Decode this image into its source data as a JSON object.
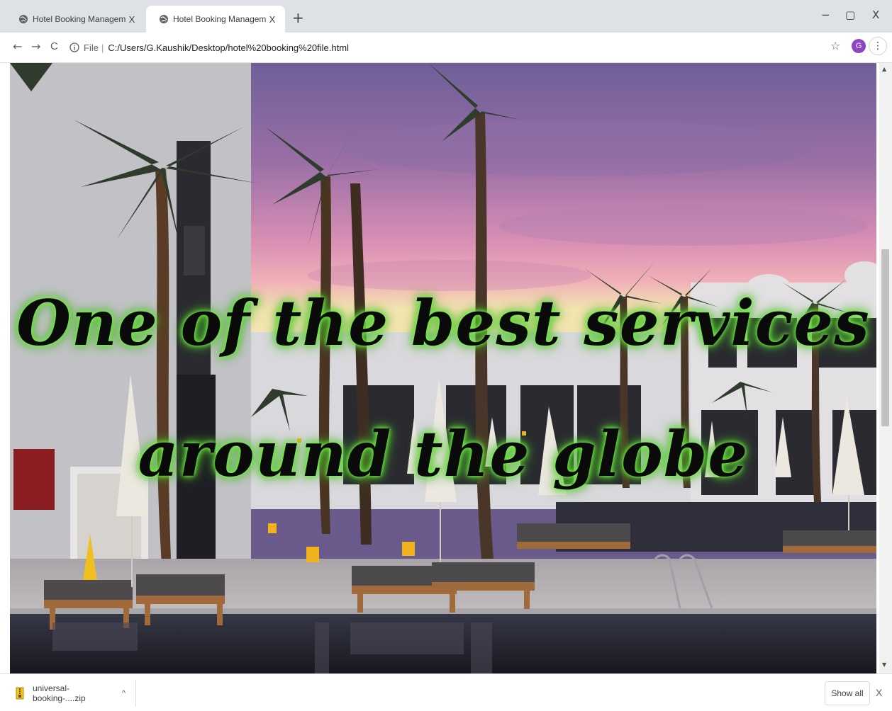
{
  "browser": {
    "tabs": [
      {
        "title": "Hotel Booking Management",
        "close": "X",
        "active": false
      },
      {
        "title": "Hotel Booking Management",
        "close": "X",
        "active": true
      }
    ],
    "new_tab": "+",
    "window_controls": {
      "minimize": "−",
      "maximize": "▢",
      "close": "X"
    },
    "nav": {
      "back": "←",
      "forward": "→",
      "reload": "C"
    },
    "address": {
      "scheme": "File",
      "separator": "|",
      "url": "C:/Users/G.Kaushik/Desktop/hotel%20booking%20file.html"
    },
    "bookmark": "☆",
    "profile_initial": "G",
    "menu": "⋮"
  },
  "hero": {
    "line1": "One of the best services",
    "line2": "around the globe",
    "glow_color": "#7fff4a"
  },
  "scrollbar": {
    "up": "▲",
    "down": "▼"
  },
  "download_shelf": {
    "file_name": "universal-booking-....zip",
    "caret": "^",
    "show_all": "Show all",
    "close": "X"
  },
  "icons": [
    "globe-icon",
    "info-icon",
    "star-icon",
    "menu-icon",
    "zip-file-icon"
  ]
}
